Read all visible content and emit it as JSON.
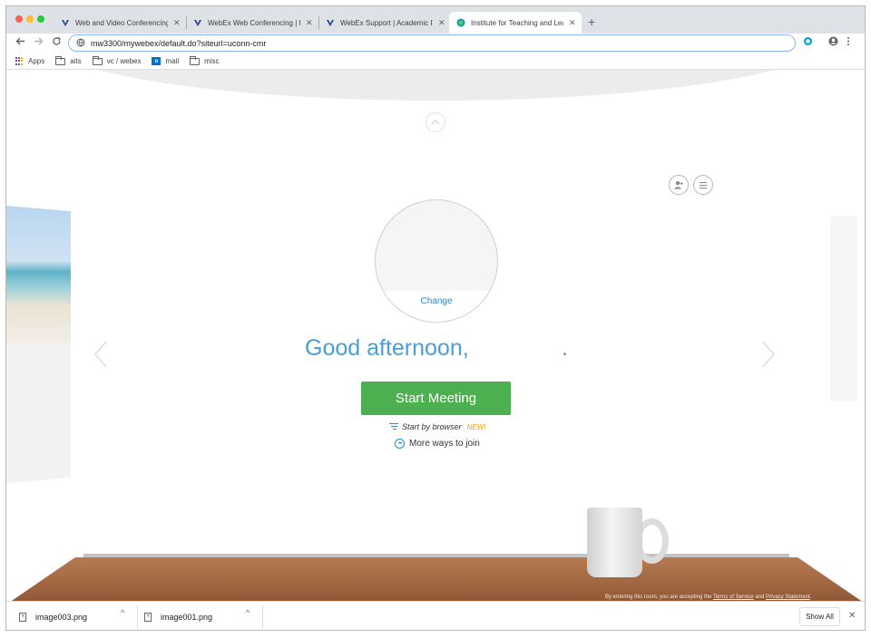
{
  "browser": {
    "tabs": [
      {
        "title": "Web and Video Conferencing |",
        "favicon": "uconn-icon",
        "active": false
      },
      {
        "title": "WebEx Web Conferencing | Inf",
        "favicon": "uconn-icon",
        "active": false
      },
      {
        "title": "WebEx Support | Academic IT",
        "favicon": "uconn-icon",
        "active": false
      },
      {
        "title": "Institute for Teaching and Lea",
        "favicon": "webex-icon",
        "active": true
      }
    ],
    "new_tab_glyph": "+",
    "tab_close_glyph": "✕",
    "url": "mw3300/mywebex/default.do?siteurl=uconn-cmr",
    "bookmarks": [
      {
        "label": "Apps",
        "icon": "apps-grid-icon"
      },
      {
        "label": "aits",
        "icon": "folder-icon"
      },
      {
        "label": "vc / webex",
        "icon": "folder-icon"
      },
      {
        "label": "mail",
        "icon": "outlook-icon"
      },
      {
        "label": "misc",
        "icon": "folder-icon"
      }
    ]
  },
  "page": {
    "avatar_change_label": "Change",
    "greeting": "Good afternoon,",
    "greeting_trailing": ".",
    "start_meeting_label": "Start Meeting",
    "start_by_browser_label": "Start by browser",
    "new_badge": "NEW!",
    "more_ways_label": "More ways to join",
    "footer_prefix": "By entering this room, you are accepting the",
    "footer_terms": "Terms of Service",
    "footer_and": "and",
    "footer_privacy": "Privacy Statement",
    "footer_suffix": "."
  },
  "downloads": {
    "items": [
      {
        "filename": "image003.png"
      },
      {
        "filename": "image001.png"
      }
    ],
    "show_all_label": "Show All"
  },
  "colors": {
    "accent_blue": "#4a9ed8",
    "start_green": "#4caf50",
    "new_badge_orange": "#f29b00"
  }
}
